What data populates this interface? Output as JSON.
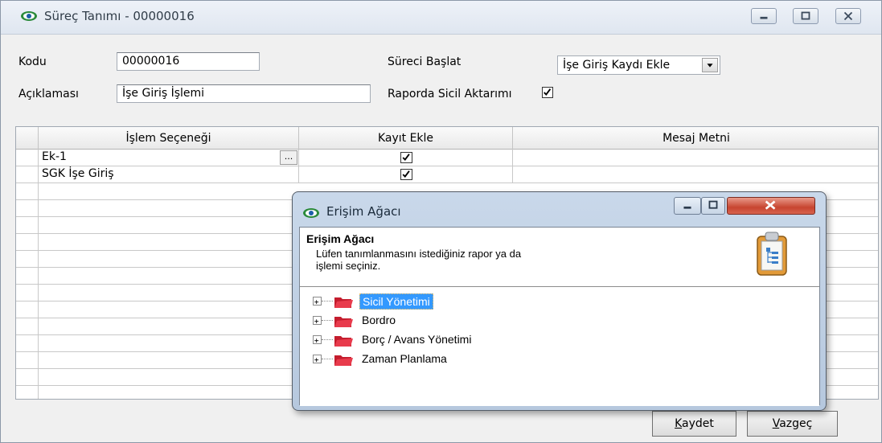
{
  "main_window": {
    "title": "Süreç Tanımı - 00000016",
    "fields": {
      "kodu_label": "Kodu",
      "kodu_value": "00000016",
      "aciklama_label": "Açıklaması",
      "aciklama_value": "İşe Giriş İşlemi",
      "sureci_baslat_label": "Süreci Başlat",
      "sureci_baslat_value": "İşe Giriş Kaydı Ekle",
      "raporda_label": "Raporda Sicil Aktarımı",
      "raporda_checked": true
    },
    "grid": {
      "columns": [
        "İşlem Seçeneği",
        "Kayıt Ekle",
        "Mesaj Metni"
      ],
      "rows": [
        {
          "islem": "Ek-1",
          "kayit_ekle": true,
          "mesaj": ""
        },
        {
          "islem": "SGK İşe Giriş",
          "kayit_ekle": true,
          "mesaj": ""
        }
      ],
      "ellipsis": "..."
    },
    "buttons": {
      "kaydet_prefix": "K",
      "kaydet_rest": "aydet",
      "vazgec_prefix": "V",
      "vazgec_rest": "azgeç"
    }
  },
  "dialog": {
    "title": "Erişim Ağacı",
    "header_title": "Erişim Ağacı",
    "header_desc_line1": "Lüfen tanımlanmasını istediğiniz rapor ya da",
    "header_desc_line2": "işlemi seçiniz.",
    "tree_items": [
      {
        "label": "Sicil Yönetimi",
        "selected": true
      },
      {
        "label": "Bordro",
        "selected": false
      },
      {
        "label": "Borç / Avans Yönetimi",
        "selected": false
      },
      {
        "label": "Zaman Planlama",
        "selected": false
      }
    ]
  },
  "colors": {
    "selection": "#3399ff",
    "folder": "#e0253a",
    "close_button": "#c74530"
  },
  "icons": [
    "eye-app-icon",
    "minimize-icon",
    "maximize-icon",
    "close-icon",
    "checkbox-icon",
    "ellipsis-icon",
    "dropdown-arrow-icon",
    "clipboard-tree-icon",
    "expand-plus-icon",
    "folder-icon"
  ]
}
